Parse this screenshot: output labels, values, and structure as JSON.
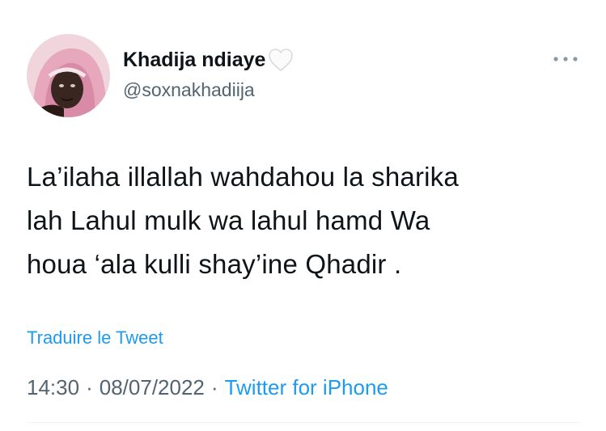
{
  "author": {
    "display_name": "Khadija ndiaye",
    "badge_icon": "white-heart-icon",
    "handle": "@soxnakhadiija",
    "avatar_icon": "avatar"
  },
  "menu": {
    "icon": "more-horizontal-icon"
  },
  "tweet": {
    "text": "La’ilaha illallah wahdahou la sharika\nlah Lahul mulk wa lahul hamd Wa\nhoua ‘ala kulli shay’ine Qhadir ."
  },
  "translate": {
    "label": "Traduire le Tweet"
  },
  "meta": {
    "time": "14:30",
    "separator": "·",
    "date": "08/07/2022",
    "source": "Twitter for iPhone"
  },
  "colors": {
    "link": "#1d9bf0",
    "secondary": "#536471",
    "text": "#0f1419",
    "divider": "#eff3f4"
  }
}
